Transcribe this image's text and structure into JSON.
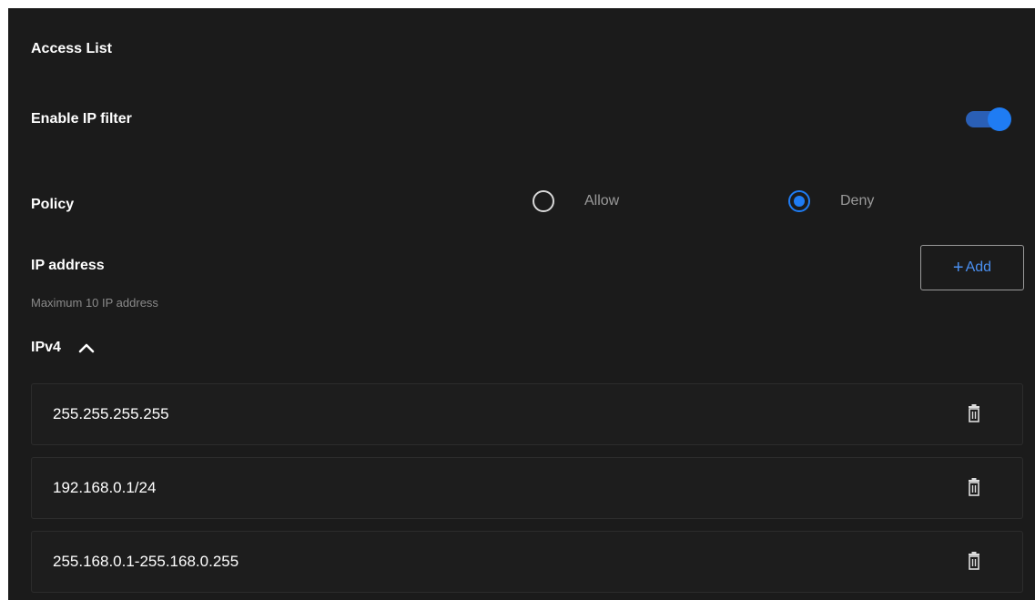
{
  "access_list": {
    "title": "Access List"
  },
  "ip_filter": {
    "label": "Enable IP filter",
    "enabled": true,
    "accent_color": "#1f7cf3"
  },
  "policy": {
    "label": "Policy",
    "options": [
      {
        "label": "Allow",
        "selected": false
      },
      {
        "label": "Deny",
        "selected": true
      }
    ]
  },
  "ip_address": {
    "label": "IP address",
    "hint": "Maximum 10 IP address",
    "add_button": {
      "icon": "plus-icon",
      "label": "Add"
    }
  },
  "ipv4_section": {
    "label": "IPv4",
    "expanded": true,
    "toggle_icon": "chevron-up-icon",
    "entries": [
      {
        "value": "255.255.255.255",
        "action_icon": "trash-icon"
      },
      {
        "value": "192.168.0.1/24",
        "action_icon": "trash-icon"
      },
      {
        "value": "255.168.0.1-255.168.0.255",
        "action_icon": "trash-icon"
      }
    ]
  }
}
